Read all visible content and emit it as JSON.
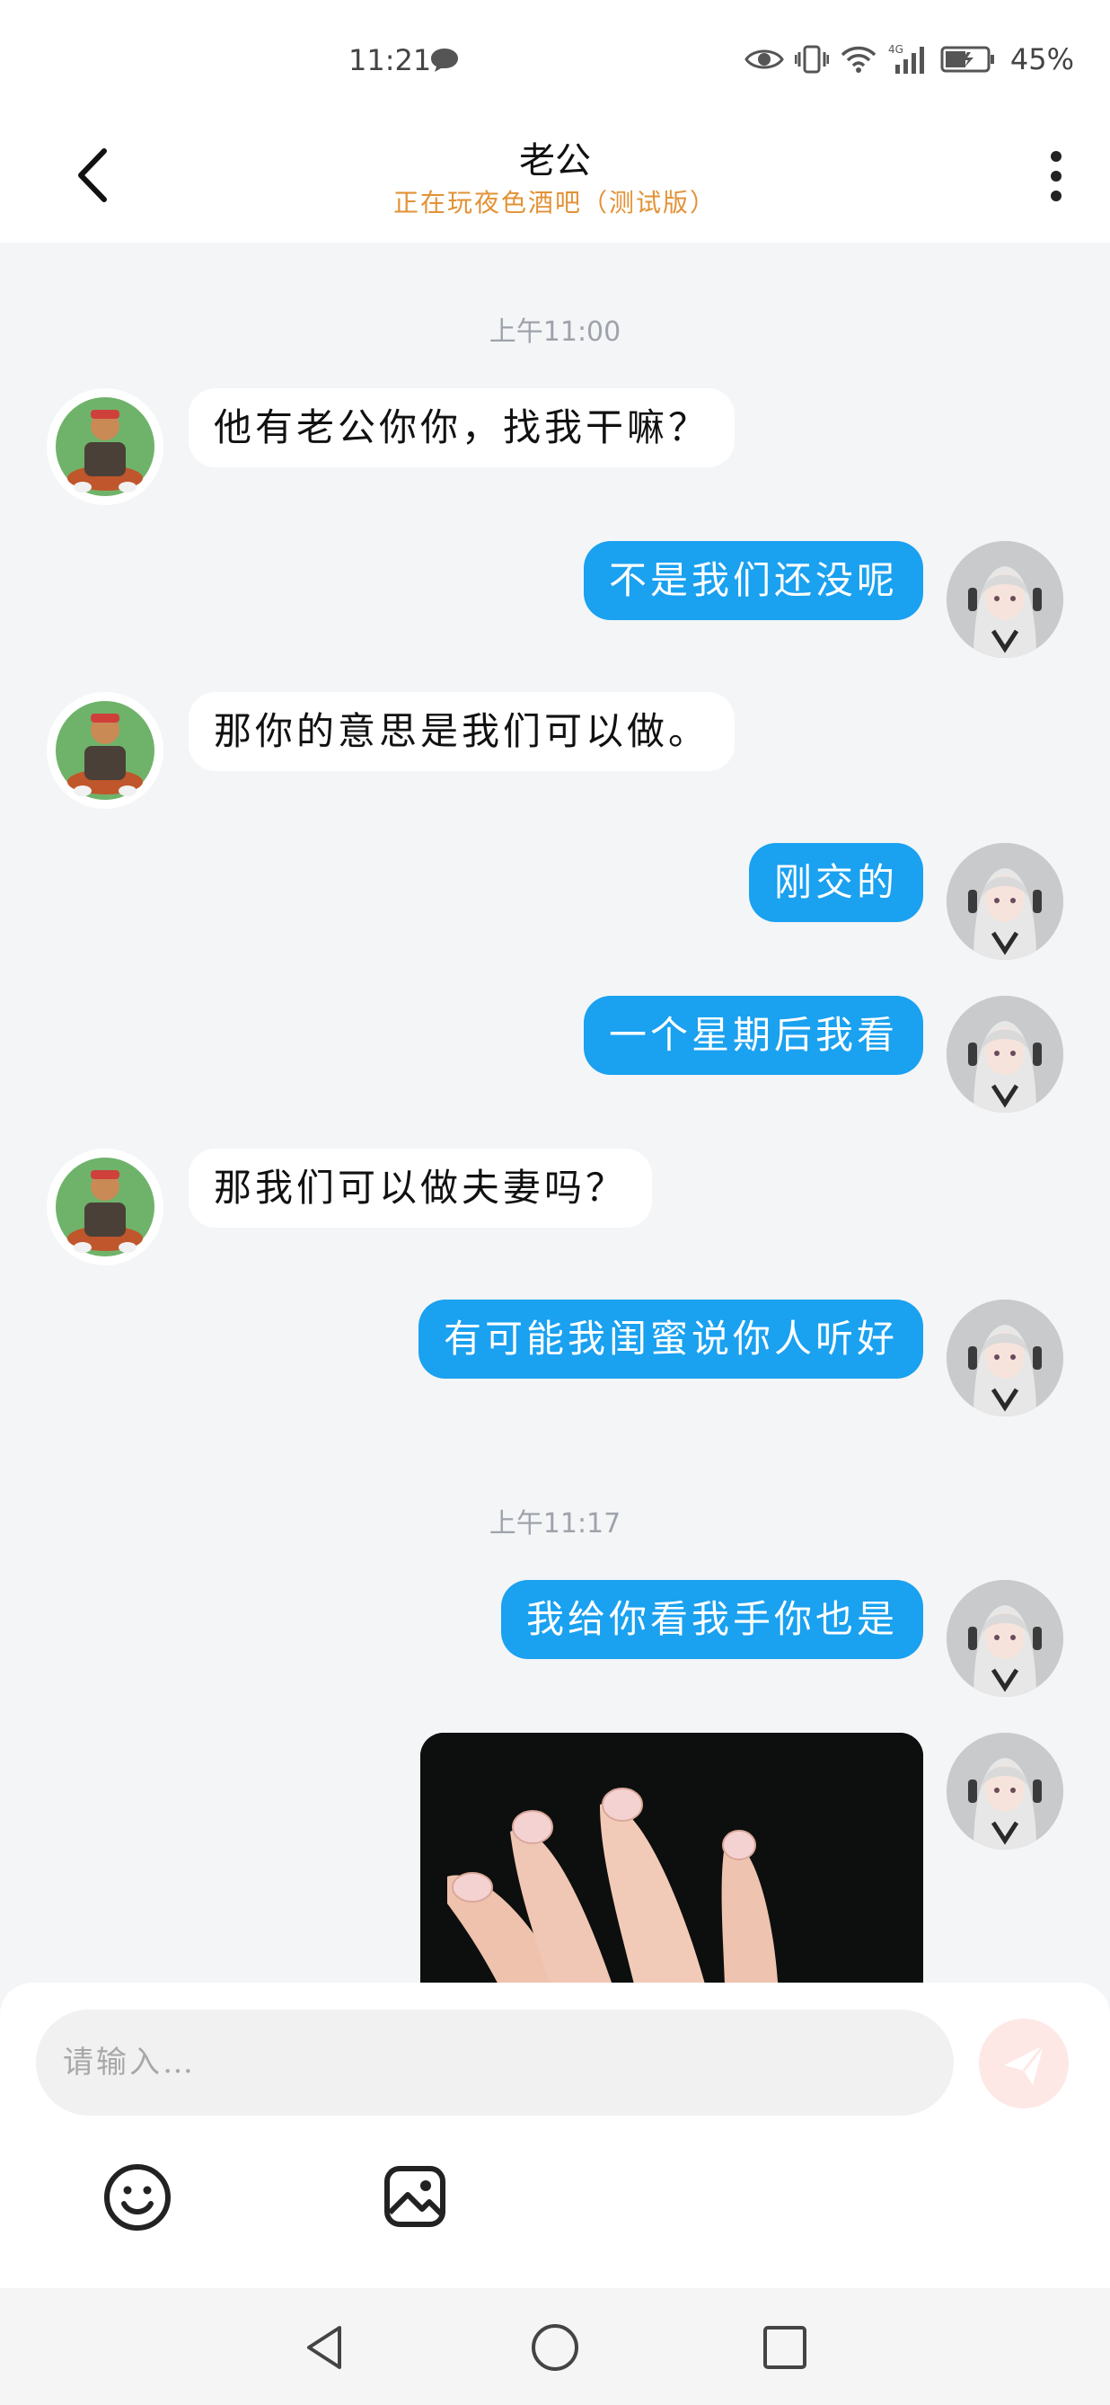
{
  "status_bar": {
    "time": "11:21",
    "network": "4G",
    "battery": "45%"
  },
  "header": {
    "title": "老公",
    "subtitle": "正在玩夜色酒吧（测试版）"
  },
  "messages": [
    {
      "type": "time",
      "text": "上午11:00"
    },
    {
      "side": "left",
      "text": "他有老公你你，找我干嘛？"
    },
    {
      "side": "right",
      "text": "不是我们还没呢"
    },
    {
      "side": "left",
      "text": "那你的意思是我们可以做。"
    },
    {
      "side": "right",
      "text": "刚交的"
    },
    {
      "side": "right",
      "text": "一个星期后我看"
    },
    {
      "side": "left",
      "text": "那我们可以做夫妻吗？"
    },
    {
      "side": "right",
      "text": "有可能我闺蜜说你人听好"
    },
    {
      "type": "time",
      "text": "上午11:17"
    },
    {
      "side": "right",
      "text": "我给你看我手你也是"
    },
    {
      "side": "right",
      "type": "image"
    }
  ],
  "input": {
    "placeholder": "请输入…"
  },
  "icons": {
    "back": "chevron-left-icon",
    "more": "more-vertical-icon",
    "send": "paper-plane-icon",
    "emoji": "smiley-icon",
    "image": "image-icon"
  },
  "colors": {
    "bubble_right": "#1aa1f0",
    "subtitle": "#e29236",
    "background": "#f4f5f7"
  }
}
